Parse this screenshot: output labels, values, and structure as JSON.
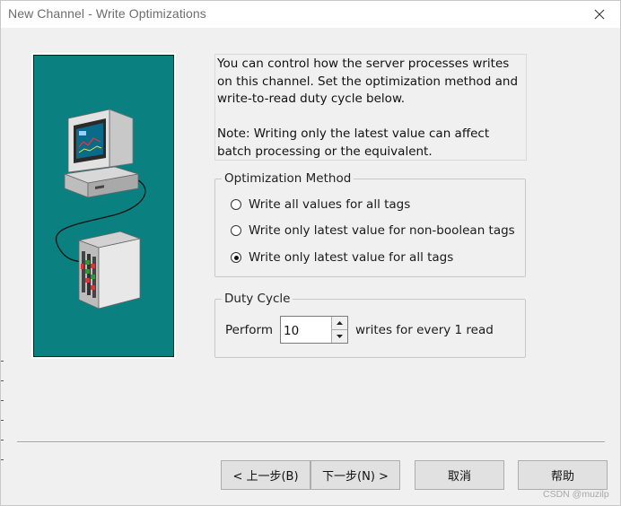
{
  "window": {
    "title": "New Channel - Write Optimizations"
  },
  "description": {
    "text": "You can control how the server processes writes on this channel.  Set the optimization method and write-to-read duty cycle below.\n\nNote:  Writing only the latest value can affect batch processing or the equivalent."
  },
  "optimization_method": {
    "label": "Optimization Method",
    "options": [
      {
        "label": "Write all values for all tags",
        "checked": false
      },
      {
        "label": "Write only latest value for non-boolean tags",
        "checked": false
      },
      {
        "label": "Write only latest value for all tags",
        "checked": true
      }
    ]
  },
  "duty_cycle": {
    "label": "Duty Cycle",
    "prefix": "Perform",
    "value": "10",
    "suffix": "writes for every 1 read"
  },
  "buttons": {
    "back": "< 上一步(B)",
    "next": "下一步(N) >",
    "cancel": "取消",
    "help": "帮助"
  },
  "watermark": "CSDN @muzilp",
  "icons": {
    "close": "close-icon",
    "spin_up": "arrow-up-icon",
    "spin_down": "arrow-down-icon",
    "illustration": "computer-plc-illustration"
  },
  "colors": {
    "illustration_bg": "#0a8080",
    "dialog_bg": "#f0f0f0",
    "title_text": "#6d6d6d"
  }
}
